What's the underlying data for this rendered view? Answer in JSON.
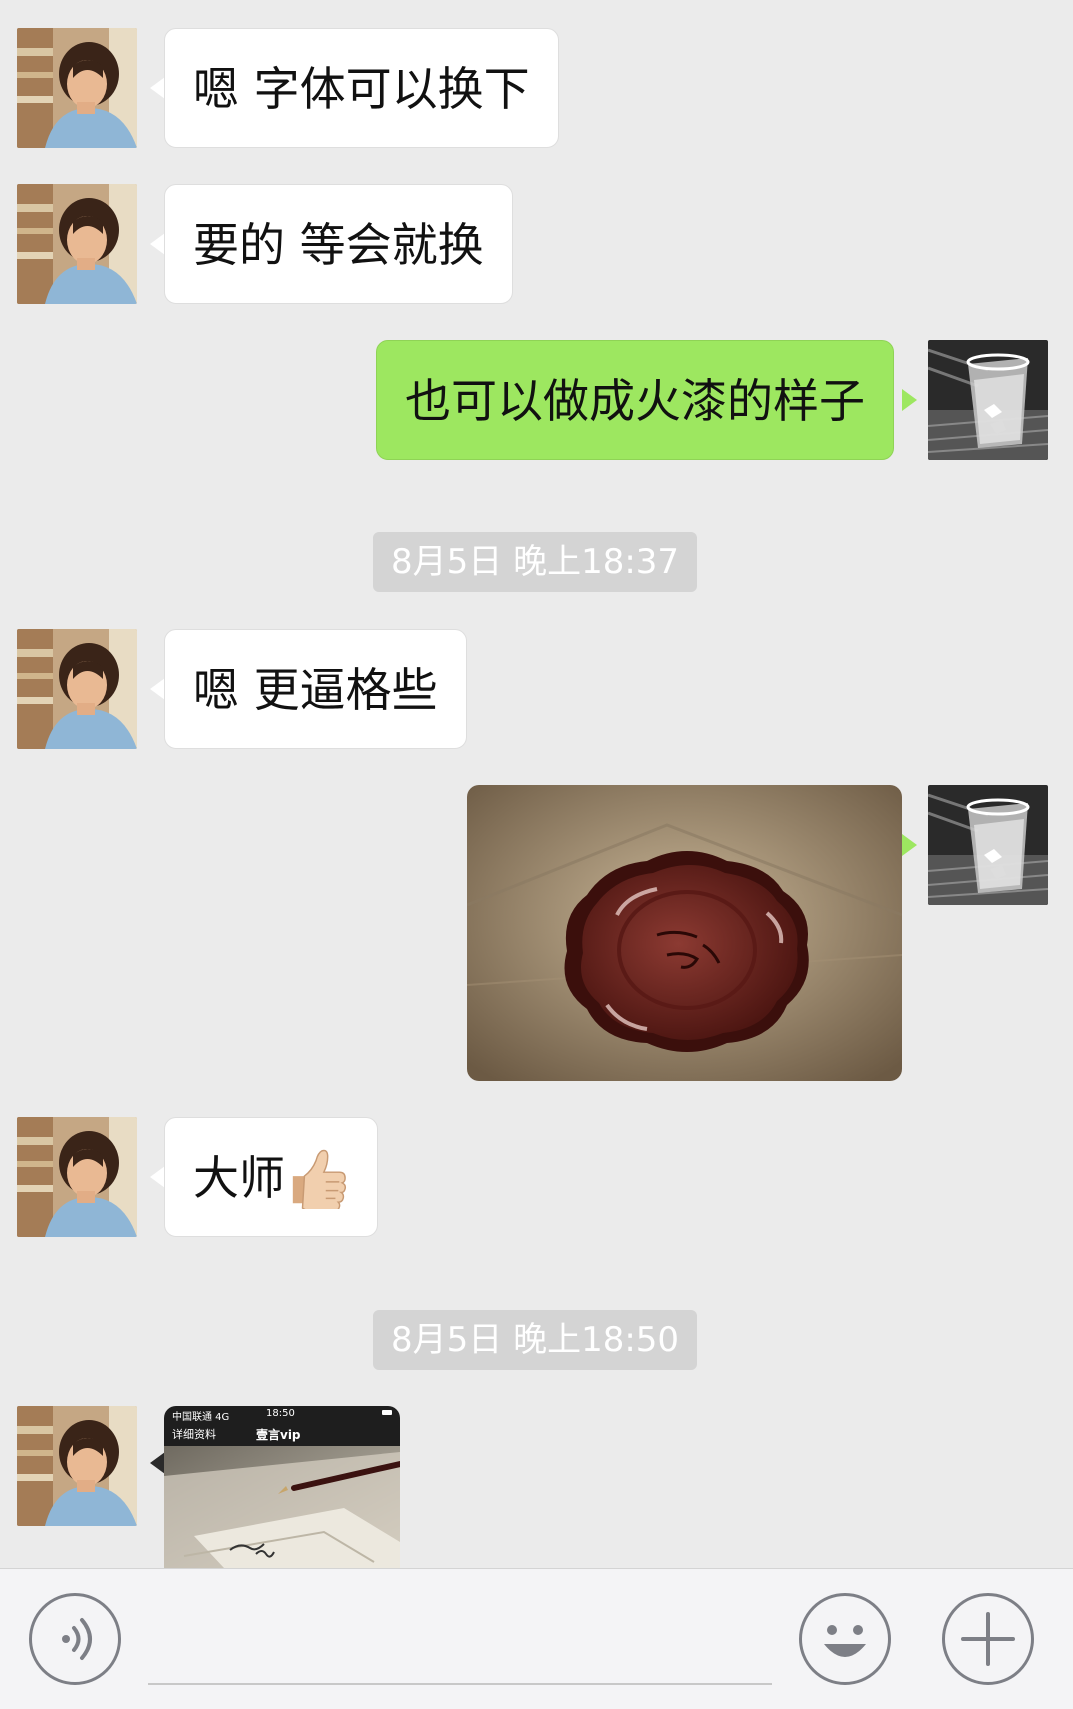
{
  "messages": [
    {
      "side": "left",
      "text": "嗯 字体可以换下"
    },
    {
      "side": "left",
      "text": "要的 等会就换"
    },
    {
      "side": "right",
      "text": "也可以做成火漆的样子"
    },
    {
      "timestamp": "8月5日 晚上18:37"
    },
    {
      "side": "left",
      "text": "嗯 更逼格些"
    },
    {
      "side": "right",
      "image": "wax-seal-photo"
    },
    {
      "side": "left",
      "text": "大师",
      "emoji": "thumbs-up-icon"
    },
    {
      "timestamp": "8月5日 晚上18:50"
    },
    {
      "side": "left",
      "image": "screenshot-photo"
    }
  ],
  "screenshot_thumb": {
    "carrier": "中国联通 4G",
    "time": "18:50",
    "back_label": "详细资料",
    "title": "壹言vip"
  },
  "input_bar": {
    "voice_icon": "voice-icon",
    "emoji_icon": "emoji-icon",
    "plus_icon": "plus-icon",
    "placeholder": ""
  },
  "colors": {
    "background": "#ebebeb",
    "incoming_bubble": "#ffffff",
    "outgoing_bubble": "#9de760",
    "timestamp_bg": "#d4d4d4",
    "input_bar": "#f4f4f6"
  }
}
